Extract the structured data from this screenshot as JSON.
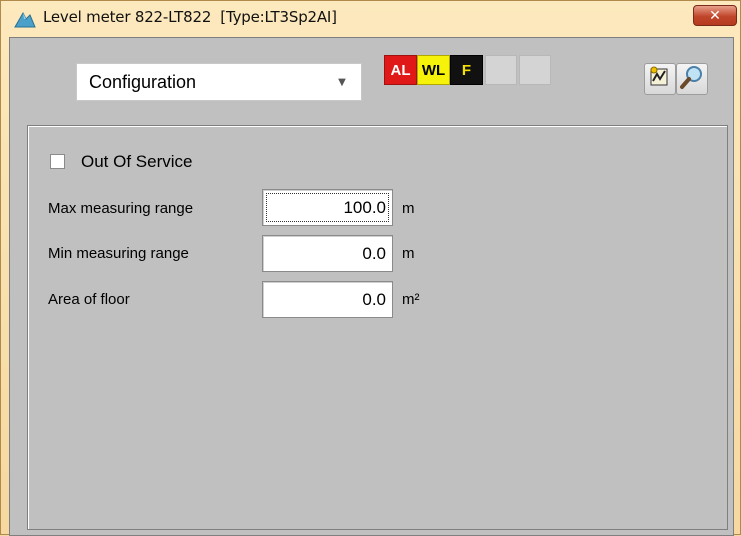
{
  "window": {
    "title": "Level meter 822-LT822  [Type:LT3Sp2AI]",
    "close_label": "✕"
  },
  "toolbar": {
    "view_select": {
      "value": "Configuration",
      "arrow": "▼"
    },
    "status_indicators": [
      {
        "label": "AL",
        "color": "#e01818"
      },
      {
        "label": "WL",
        "color": "#f7f20a"
      },
      {
        "label": "F",
        "color": "#111111"
      },
      {
        "label": "",
        "color": "#d4d4d4"
      },
      {
        "label": "",
        "color": "#d4d4d4"
      }
    ],
    "icons": [
      "trend-icon",
      "magnifier-icon"
    ]
  },
  "form": {
    "out_of_service": {
      "label": "Out Of Service",
      "checked": false
    },
    "fields": [
      {
        "label": "Max measuring range",
        "value": "100.0",
        "unit": "m"
      },
      {
        "label": "Min measuring range",
        "value": "0.0",
        "unit": "m"
      },
      {
        "label": "Area of floor",
        "value": "0.0",
        "unit": "m²"
      }
    ]
  }
}
